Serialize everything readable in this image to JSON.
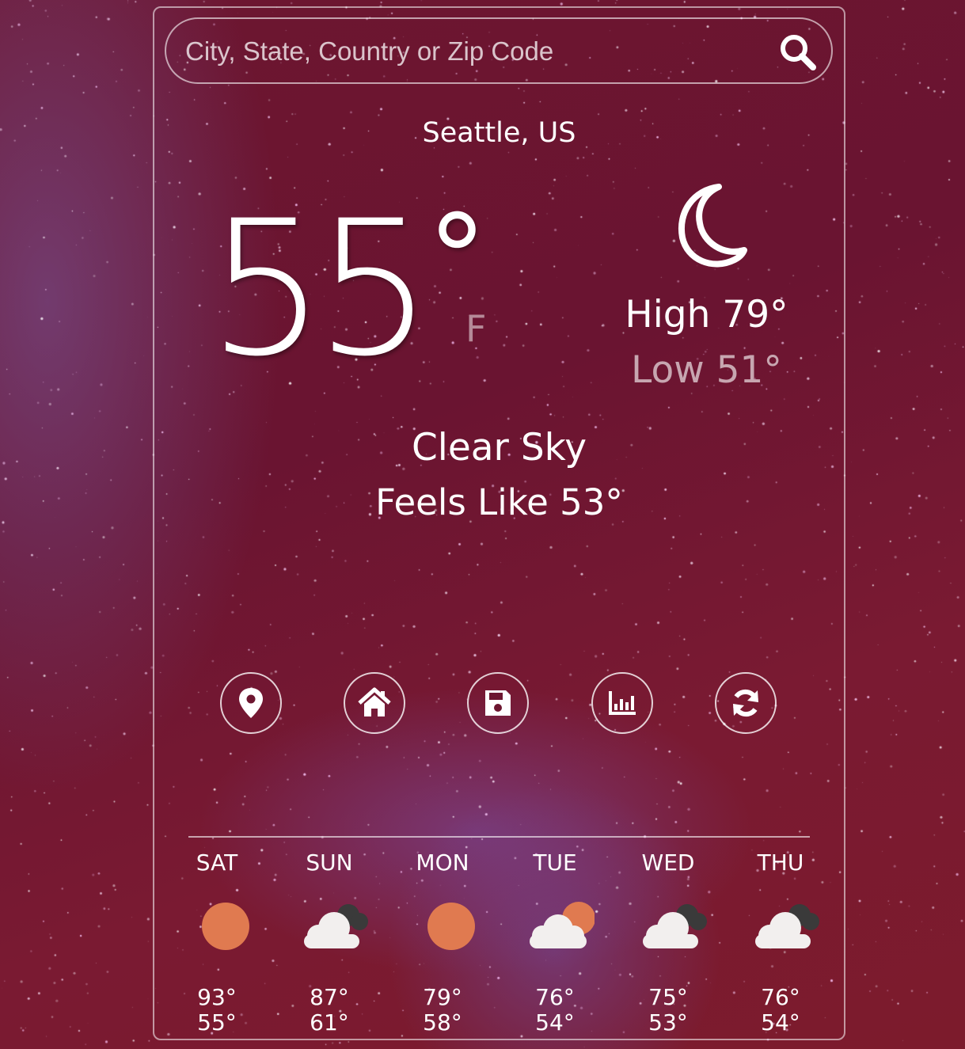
{
  "search": {
    "placeholder": "City, State, Country or Zip Code",
    "value": ""
  },
  "location": "Seattle, US",
  "current": {
    "temperature": "55",
    "degree_symbol": "°",
    "unit": "F",
    "icon": "moon-icon",
    "high": "High 79°",
    "low": "Low 51°",
    "condition": "Clear Sky",
    "feels_like": "Feels Like 53°"
  },
  "actions": [
    {
      "name": "location-button",
      "icon": "map-pin-icon"
    },
    {
      "name": "home-button",
      "icon": "home-icon"
    },
    {
      "name": "save-button",
      "icon": "floppy-disk-icon"
    },
    {
      "name": "chart-button",
      "icon": "bar-chart-icon"
    },
    {
      "name": "refresh-button",
      "icon": "refresh-icon"
    }
  ],
  "forecast": [
    {
      "day": "SAT",
      "icon": "sun-icon",
      "high": "93°",
      "low": "55°"
    },
    {
      "day": "SUN",
      "icon": "cloudy-icon",
      "high": "87°",
      "low": "61°"
    },
    {
      "day": "MON",
      "icon": "sun-icon",
      "high": "79°",
      "low": "58°"
    },
    {
      "day": "TUE",
      "icon": "partly-cloudy-icon",
      "high": "76°",
      "low": "54°"
    },
    {
      "day": "WED",
      "icon": "cloudy-icon",
      "high": "75°",
      "low": "53°"
    },
    {
      "day": "THU",
      "icon": "cloudy-icon",
      "high": "76°",
      "low": "54°"
    }
  ],
  "colors": {
    "sun": "#e07a50",
    "cloud": "#f2efee",
    "dark_cloud": "#3a3a3a",
    "background": "#6d1630"
  }
}
